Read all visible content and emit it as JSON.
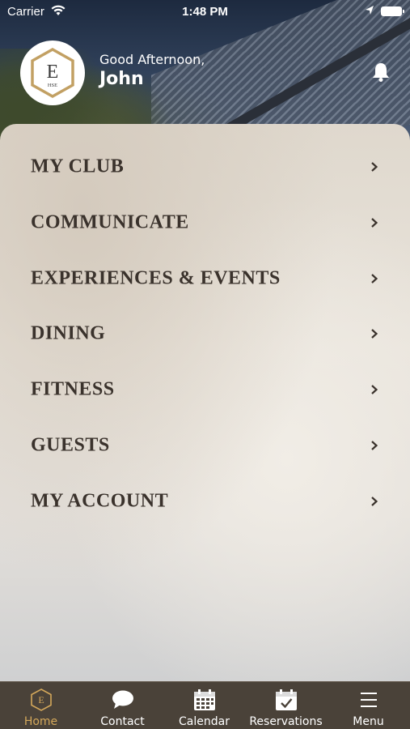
{
  "status_bar": {
    "carrier": "Carrier",
    "time": "1:48 PM"
  },
  "header": {
    "logo": {
      "letter": "E",
      "sub": "HSE"
    },
    "greeting": "Good Afternoon,",
    "user_name": "John"
  },
  "menu": {
    "items": [
      {
        "label": "MY CLUB"
      },
      {
        "label": "COMMUNICATE"
      },
      {
        "label": "EXPERIENCES & EVENTS"
      },
      {
        "label": "DINING"
      },
      {
        "label": "FITNESS"
      },
      {
        "label": "GUESTS"
      },
      {
        "label": "MY ACCOUNT"
      }
    ]
  },
  "tab_bar": {
    "tabs": [
      {
        "label": "Home",
        "icon": "home-logo-icon",
        "active": true
      },
      {
        "label": "Contact",
        "icon": "chat-bubble-icon"
      },
      {
        "label": "Calendar",
        "icon": "calendar-icon"
      },
      {
        "label": "Reservations",
        "icon": "calendar-check-icon"
      },
      {
        "label": "Menu",
        "icon": "hamburger-menu-icon"
      }
    ]
  },
  "colors": {
    "accent_gold": "#c2a063",
    "tab_bar_bg": "#4a4239",
    "active_tab": "#d3a75a",
    "menu_text": "#3a322c"
  }
}
